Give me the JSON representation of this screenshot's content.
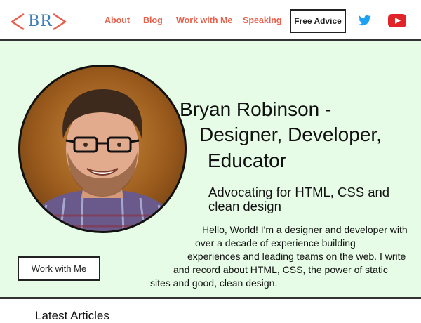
{
  "header": {
    "logo_text": "BR",
    "logo_color": "#3b7fb8",
    "logo_bracket_color": "#e8604c",
    "nav": [
      {
        "label": "About"
      },
      {
        "label": "Blog"
      },
      {
        "label": "Work with Me"
      },
      {
        "label": "Speaking"
      }
    ],
    "cta_label": "Free Advice",
    "social": {
      "twitter_icon": "twitter-bird-icon",
      "youtube_icon": "youtube-play-icon",
      "twitter_color": "#1da1f2",
      "youtube_color": "#e0242a"
    },
    "nav_color": "#e8604c"
  },
  "hero": {
    "background": "#e6fce6",
    "title_lines": [
      "Bryan Robinson -",
      "Designer, Developer,",
      "Educator"
    ],
    "subtitle_lines": [
      "Advocating for HTML, CSS and",
      "clean design"
    ],
    "intro_lines": [
      "Hello, World! I'm a designer and developer with",
      "over a decade of experience building",
      "experiences and leading teams on the web. I write",
      "and record about HTML, CSS, the power of static",
      "sites and good, clean design."
    ],
    "button_label": "Work with Me"
  },
  "latest": {
    "heading": "Latest Articles"
  }
}
